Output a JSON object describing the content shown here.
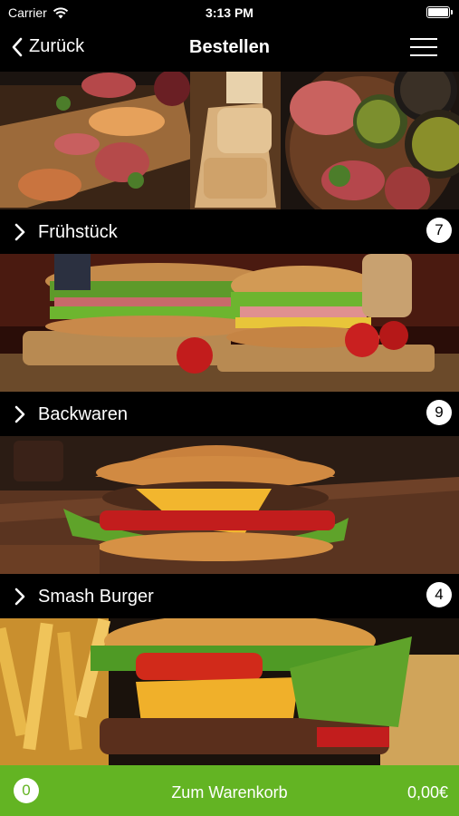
{
  "status_bar": {
    "carrier": "Carrier",
    "time": "3:13 PM"
  },
  "nav": {
    "back_label": "Zurück",
    "title": "Bestellen"
  },
  "categories": [
    {
      "name": "Frühstück",
      "count": "7"
    },
    {
      "name": "Backwaren",
      "count": "9"
    },
    {
      "name": "Smash Burger",
      "count": "4"
    }
  ],
  "cart": {
    "count": "0",
    "label": "Zum Warenkorb",
    "total": "0,00€"
  },
  "colors": {
    "accent": "#63b423",
    "background": "#000000"
  },
  "icons": [
    "wifi-icon",
    "battery-icon",
    "chevron-left-icon",
    "hamburger-menu-icon",
    "chevron-right-icon"
  ]
}
